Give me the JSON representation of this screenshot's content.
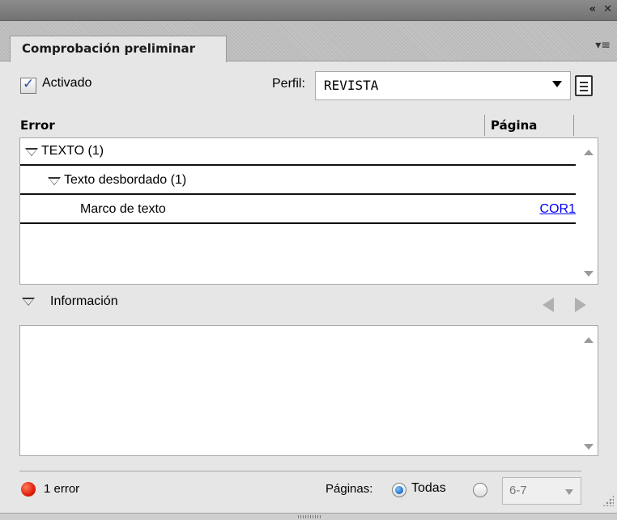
{
  "window": {
    "collapse_icon": "double-chevron-left-icon",
    "close_icon": "close-icon"
  },
  "tab": {
    "title": "Comprobación preliminar",
    "menu_icon": "panel-menu-icon"
  },
  "controls": {
    "enabled_label": "Activado",
    "enabled_checked": true,
    "profile_label": "Perfil:",
    "profile_value": "REVISTA",
    "profile_icon": "profile-document-icon"
  },
  "errors_table": {
    "columns": [
      "Error",
      "Página"
    ],
    "rows": [
      {
        "label": "TEXTO (1)",
        "level": 0,
        "expanded": true,
        "page": ""
      },
      {
        "label": "Texto desbordado (1)",
        "level": 1,
        "expanded": true,
        "page": ""
      },
      {
        "label": "Marco de texto",
        "level": 2,
        "page": "COR1"
      }
    ]
  },
  "info": {
    "label": "Información",
    "expanded": true
  },
  "status": {
    "error_count": "1 error",
    "error_color": "#e0200c",
    "pages_label": "Páginas:",
    "option_all": "Todas",
    "option_all_selected": true,
    "range_value": "6-7"
  },
  "colors": {
    "link": "#0000ee",
    "panel_bg": "#e6e6e6",
    "titlebar": "#7f7f7f"
  }
}
